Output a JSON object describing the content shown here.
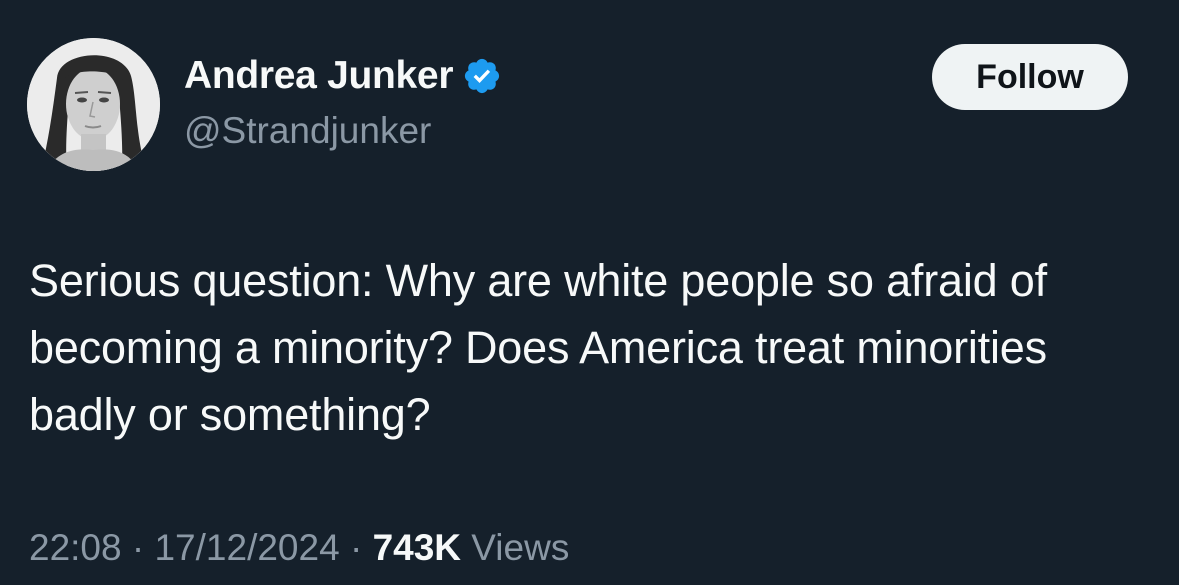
{
  "author": {
    "display_name": "Andrea Junker",
    "handle": "@Strandjunker",
    "verified": true,
    "verified_color": "#1d9bf0"
  },
  "follow_button": {
    "label": "Follow"
  },
  "tweet": {
    "text": "Serious question: Why are white people so afraid of becoming a minority? Does America treat minorities badly or something?"
  },
  "meta": {
    "time": "22:08",
    "separator": "·",
    "date": "17/12/2024",
    "views_count": "743K",
    "views_label": "Views"
  },
  "colors": {
    "background": "#15202b",
    "text_primary": "#f7f9f9",
    "text_secondary": "#8b98a5",
    "button_bg": "#eff3f4"
  }
}
